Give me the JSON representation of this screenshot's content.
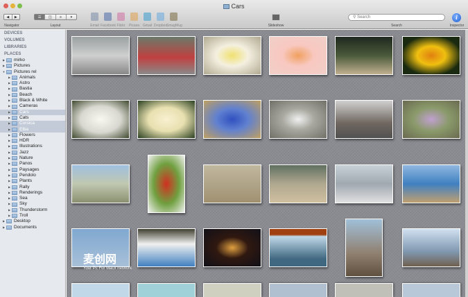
{
  "window": {
    "title": "Cars"
  },
  "toolbar": {
    "navigator_label": "Navigator",
    "layout_label": "Layout",
    "share": [
      "Email",
      "Facebook",
      "Flickr",
      "Picasa",
      "Gmail",
      "Dropbox",
      "SmugMug"
    ],
    "slideshow_label": "Slideshow",
    "search_placeholder": "Search",
    "search_label": "Search",
    "inspector_label": "Inspector"
  },
  "sidebar": {
    "sections": [
      "DEVICES",
      "VOLUMES",
      "LIBRARIES",
      "PLACES"
    ],
    "items": [
      {
        "label": "mirko",
        "level": 0
      },
      {
        "label": "Pictures",
        "level": 0
      },
      {
        "label": "Pictures rel",
        "level": 0,
        "open": true
      },
      {
        "label": "Animals",
        "level": 1
      },
      {
        "label": "Astro",
        "level": 1
      },
      {
        "label": "Bastia",
        "level": 1
      },
      {
        "label": "Beach",
        "level": 1
      },
      {
        "label": "Black & White",
        "level": 1
      },
      {
        "label": "Cameras",
        "level": 1
      },
      {
        "label": "Cars",
        "level": 1,
        "sel": true
      },
      {
        "label": "Cats",
        "level": 1
      },
      {
        "label": "Corsica",
        "level": 1,
        "sel": true
      },
      {
        "label": "Elba",
        "level": 1,
        "sel": true
      },
      {
        "label": "Flowers",
        "level": 1
      },
      {
        "label": "HDR",
        "level": 1
      },
      {
        "label": "Illustrations",
        "level": 1
      },
      {
        "label": "Jazz",
        "level": 1
      },
      {
        "label": "Nature",
        "level": 1
      },
      {
        "label": "Panos",
        "level": 1
      },
      {
        "label": "Paysages",
        "level": 1
      },
      {
        "label": "Pendolo",
        "level": 1
      },
      {
        "label": "Plants",
        "level": 1
      },
      {
        "label": "Rally",
        "level": 1
      },
      {
        "label": "Renderings",
        "level": 1
      },
      {
        "label": "Sea",
        "level": 1
      },
      {
        "label": "Sky",
        "level": 1
      },
      {
        "label": "Thunderstorm",
        "level": 1
      },
      {
        "label": "Troll",
        "level": 1
      },
      {
        "label": "Desktop",
        "level": 0
      },
      {
        "label": "Documents",
        "level": 0
      }
    ]
  },
  "watermark": {
    "title": "麦创网",
    "subtitle": "Your Pc For Macx network"
  }
}
